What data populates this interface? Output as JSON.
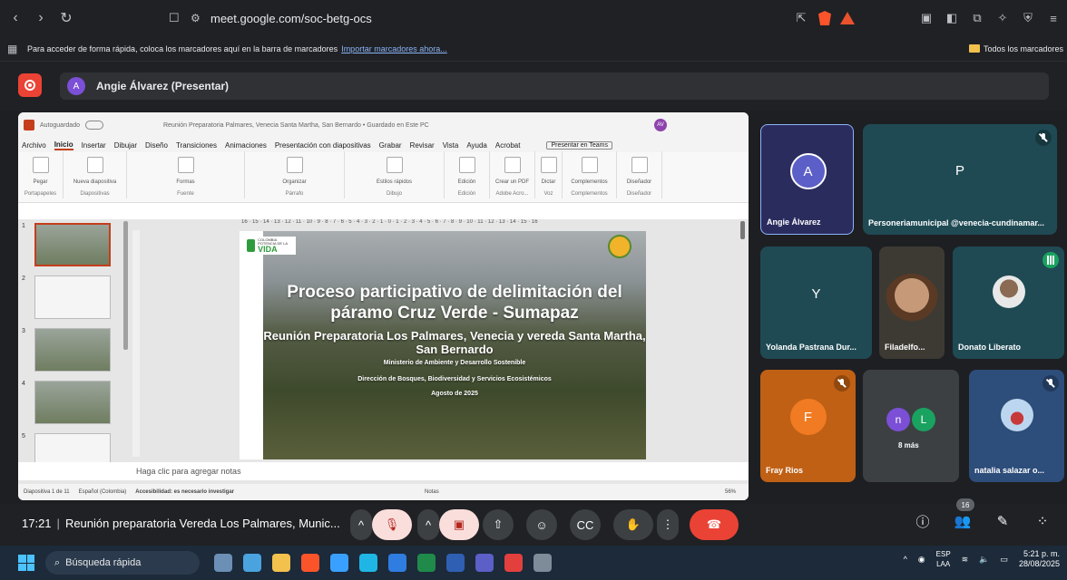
{
  "browser": {
    "back_icon": "‹",
    "forward_icon": "›",
    "reload_icon": "↻",
    "url": "meet.google.com/soc-betg-ocs",
    "bookmarks_hint": "Para acceder de forma rápida, coloca los marcadores aquí en la barra de marcadores",
    "bookmarks_link": "Importar marcadores ahora...",
    "all_bookmarks": "Todos los marcadores"
  },
  "meet_header": {
    "presenter_initial": "A",
    "presenter_label": "Angie Álvarez (Presentar)"
  },
  "ppt": {
    "autosave": "Autoguardado",
    "doc_title": "Reunión Preparatoria Palmares, Venecia Santa Martha, San Bernardo • Guardado en Este PC",
    "user_initials": "AV",
    "tabs": [
      "Archivo",
      "Inicio",
      "Insertar",
      "Dibujar",
      "Diseño",
      "Transiciones",
      "Animaciones",
      "Presentación con diapositivas",
      "Grabar",
      "Revisar",
      "Vista",
      "Ayuda",
      "Acrobat"
    ],
    "present_teams": "Presentar en Teams",
    "ribbon_groups": [
      "Portapapeles",
      "Diapositivas",
      "Fuente",
      "Párrafo",
      "Dibujo",
      "Edición",
      "Adobe Acro...",
      "Voz",
      "Complementos",
      "Diseñador"
    ],
    "ribbon_buttons": [
      "Pegar",
      "Nueva diapositiva",
      "Formas",
      "Organizar",
      "Estilos rápidos",
      "Edición",
      "Crear un PDF",
      "Dictar",
      "Complementos",
      "Diseñador"
    ],
    "ruler": "16 · 15 · 14 · 13 · 12 · 11 · 10 · 9 · 8 · 7 · 6 · 5 · 4 · 3 · 2 · 1 · 0 · 1 · 2 · 3 · 4 · 5 · 6 · 7 · 8 · 9 · 10 · 11 · 12 · 13 · 14 · 15 · 16",
    "thumb_numbers": [
      "1",
      "2",
      "3",
      "4",
      "5"
    ],
    "slide": {
      "logo_small": "COLOMBIA POTENCIA DE LA",
      "logo_big": "VIDA",
      "title": "Proceso participativo de delimitación del páramo Cruz Verde - Sumapaz",
      "subtitle": "Reunión Preparatoria Los Palmares, Venecia y vereda Santa Martha, San Bernardo",
      "line1": "Ministerio de Ambiente y Desarrollo Sostenible",
      "line2": "Dirección de Bosques, Biodiversidad y Servicios Ecosistémicos",
      "line3": "Agosto de 2025"
    },
    "notes_placeholder": "Haga clic para agregar notas",
    "status": {
      "slide_count": "Diapositiva 1 de 11",
      "language": "Español (Colombia)",
      "accessibility": "Accesibilidad: es necesario investigar",
      "notes": "Notas",
      "zoom": "56%"
    }
  },
  "participants": [
    {
      "name": "Angie Álvarez",
      "initial": "A",
      "bg": "#2b2c5e",
      "avatar_bg": "#5b5fc7"
    },
    {
      "name": "Personeriamunicipal @venecia-cundinamar...",
      "initial": "P",
      "bg": "#1f4a54",
      "avatar_bg": "#1f4a54"
    },
    {
      "name": "Yolanda Pastrana Dur...",
      "initial": "Y",
      "bg": "#1f4a54",
      "avatar_bg": "#1f4a54"
    },
    {
      "name": "Filadelfo...",
      "initial": "",
      "bg": "#3d3a34"
    },
    {
      "name": "Donato Liberato",
      "initial": "",
      "bg": "#1f4a54"
    },
    {
      "name": "Fray Rios",
      "initial": "F",
      "bg": "#c06015",
      "avatar_bg": "#f07b22"
    },
    {
      "name": "8 más",
      "initial": "n",
      "initial2": "L",
      "bg": "#3c4043"
    },
    {
      "name": "natalia salazar o...",
      "initial": "",
      "bg": "#2d4d7a"
    }
  ],
  "meet_bottom": {
    "time": "17:21",
    "meeting_name": "Reunión preparatoria Vereda Los Palmares, Munic...",
    "participant_count": "16"
  },
  "taskbar": {
    "search_placeholder": "Búsqueda rápida",
    "lang_top": "ESP",
    "lang_bottom": "LAA",
    "time": "5:21 p. m.",
    "date": "28/08/2025"
  }
}
